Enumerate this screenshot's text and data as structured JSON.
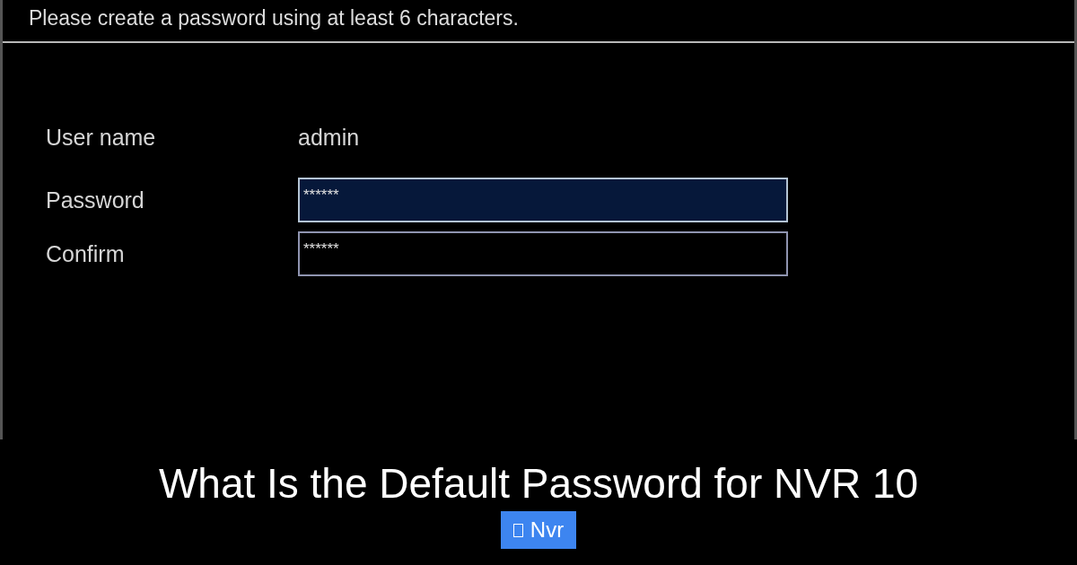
{
  "dialog": {
    "instruction": "Please create a password using at least 6 characters.",
    "fields": [
      {
        "kind": "text",
        "label": "User name",
        "value": "admin"
      },
      {
        "kind": "input",
        "label": "Password",
        "value": "******",
        "focused": true
      },
      {
        "kind": "input",
        "label": "Confirm",
        "value": "******",
        "focused": false
      }
    ]
  },
  "caption": {
    "title": "What Is the Default Password for NVR 10",
    "tag": "Nvr"
  }
}
